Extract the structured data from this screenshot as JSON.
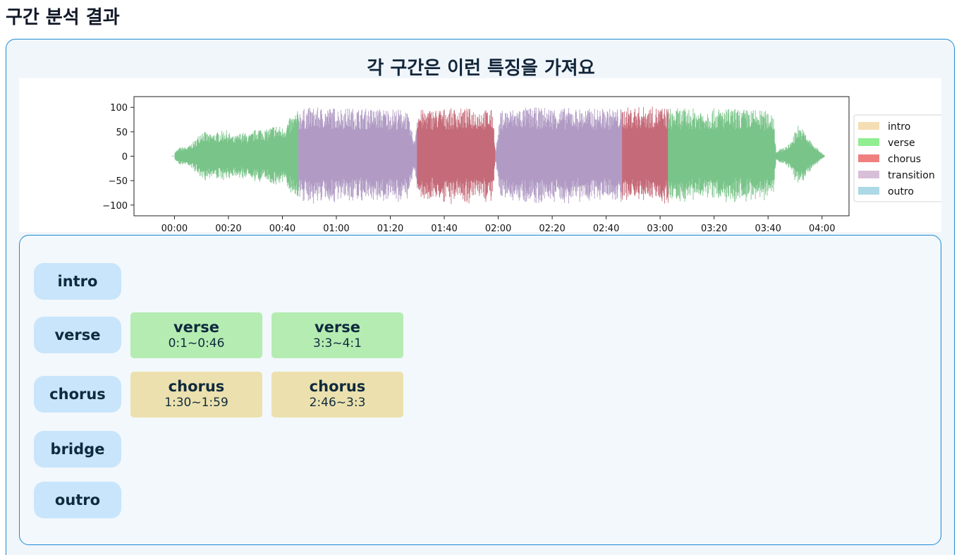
{
  "page": {
    "heading": "구간 분석 결과"
  },
  "card": {
    "title": "각 구간은 이런 특징을 가져요"
  },
  "colors": {
    "intro": "#f5deb3",
    "verse": "#90ee90",
    "chorus": "#f08080",
    "transition": "#d8bfd8",
    "outro": "#add8e6",
    "verse_box": "#b5ecb2",
    "chorus_box": "#ece1ae",
    "pill": "#c8e5fb",
    "border": "#1d8ad2"
  },
  "chart_data": {
    "type": "area",
    "xlim": [
      -15,
      250
    ],
    "ylim": [
      -122,
      122
    ],
    "x_ticks": [
      0,
      20,
      40,
      60,
      80,
      100,
      120,
      140,
      160,
      180,
      200,
      220,
      240
    ],
    "x_tick_labels": [
      "00:00",
      "00:20",
      "00:40",
      "01:00",
      "01:20",
      "01:40",
      "02:00",
      "02:20",
      "02:40",
      "03:00",
      "03:20",
      "03:40",
      "04:00"
    ],
    "y_ticks": [
      100,
      50,
      0,
      -50,
      -100
    ],
    "y_tick_labels": [
      "100",
      "50",
      "0",
      "−50",
      "−100"
    ],
    "legend": [
      "intro",
      "verse",
      "chorus",
      "transition",
      "outro"
    ],
    "legend_position": "right",
    "segments": [
      {
        "label": "verse",
        "start": 0,
        "end": 46
      },
      {
        "label": "transition",
        "start": 46,
        "end": 90
      },
      {
        "label": "chorus",
        "start": 90,
        "end": 119
      },
      {
        "label": "transition",
        "start": 119,
        "end": 166
      },
      {
        "label": "chorus",
        "start": 166,
        "end": 183
      },
      {
        "label": "verse",
        "start": 183,
        "end": 241
      }
    ],
    "envelope": [
      [
        0,
        8
      ],
      [
        2,
        18
      ],
      [
        5,
        20
      ],
      [
        8,
        35
      ],
      [
        10,
        55
      ],
      [
        13,
        45
      ],
      [
        16,
        50
      ],
      [
        19,
        55
      ],
      [
        22,
        40
      ],
      [
        25,
        50
      ],
      [
        28,
        45
      ],
      [
        31,
        60
      ],
      [
        34,
        55
      ],
      [
        37,
        65
      ],
      [
        40,
        60
      ],
      [
        43,
        80
      ],
      [
        46,
        95
      ],
      [
        50,
        100
      ],
      [
        60,
        100
      ],
      [
        70,
        98
      ],
      [
        80,
        98
      ],
      [
        86,
        96
      ],
      [
        89,
        30
      ],
      [
        90,
        95
      ],
      [
        100,
        98
      ],
      [
        110,
        98
      ],
      [
        118,
        95
      ],
      [
        119,
        10
      ],
      [
        121,
        95
      ],
      [
        130,
        100
      ],
      [
        140,
        100
      ],
      [
        150,
        98
      ],
      [
        160,
        98
      ],
      [
        166,
        98
      ],
      [
        167,
        100
      ],
      [
        175,
        102
      ],
      [
        183,
        100
      ],
      [
        184,
        98
      ],
      [
        195,
        98
      ],
      [
        205,
        98
      ],
      [
        215,
        96
      ],
      [
        222,
        92
      ],
      [
        223,
        10
      ],
      [
        228,
        25
      ],
      [
        231,
        65
      ],
      [
        233,
        55
      ],
      [
        236,
        30
      ],
      [
        239,
        12
      ],
      [
        241,
        2
      ]
    ]
  },
  "sections": [
    {
      "label": "intro",
      "segments": []
    },
    {
      "label": "verse",
      "segments": [
        {
          "name": "verse",
          "range": "0:1~0:46"
        },
        {
          "name": "verse",
          "range": "3:3~4:1"
        }
      ]
    },
    {
      "label": "chorus",
      "segments": [
        {
          "name": "chorus",
          "range": "1:30~1:59"
        },
        {
          "name": "chorus",
          "range": "2:46~3:3"
        }
      ]
    },
    {
      "label": "bridge",
      "segments": []
    },
    {
      "label": "outro",
      "segments": []
    }
  ]
}
